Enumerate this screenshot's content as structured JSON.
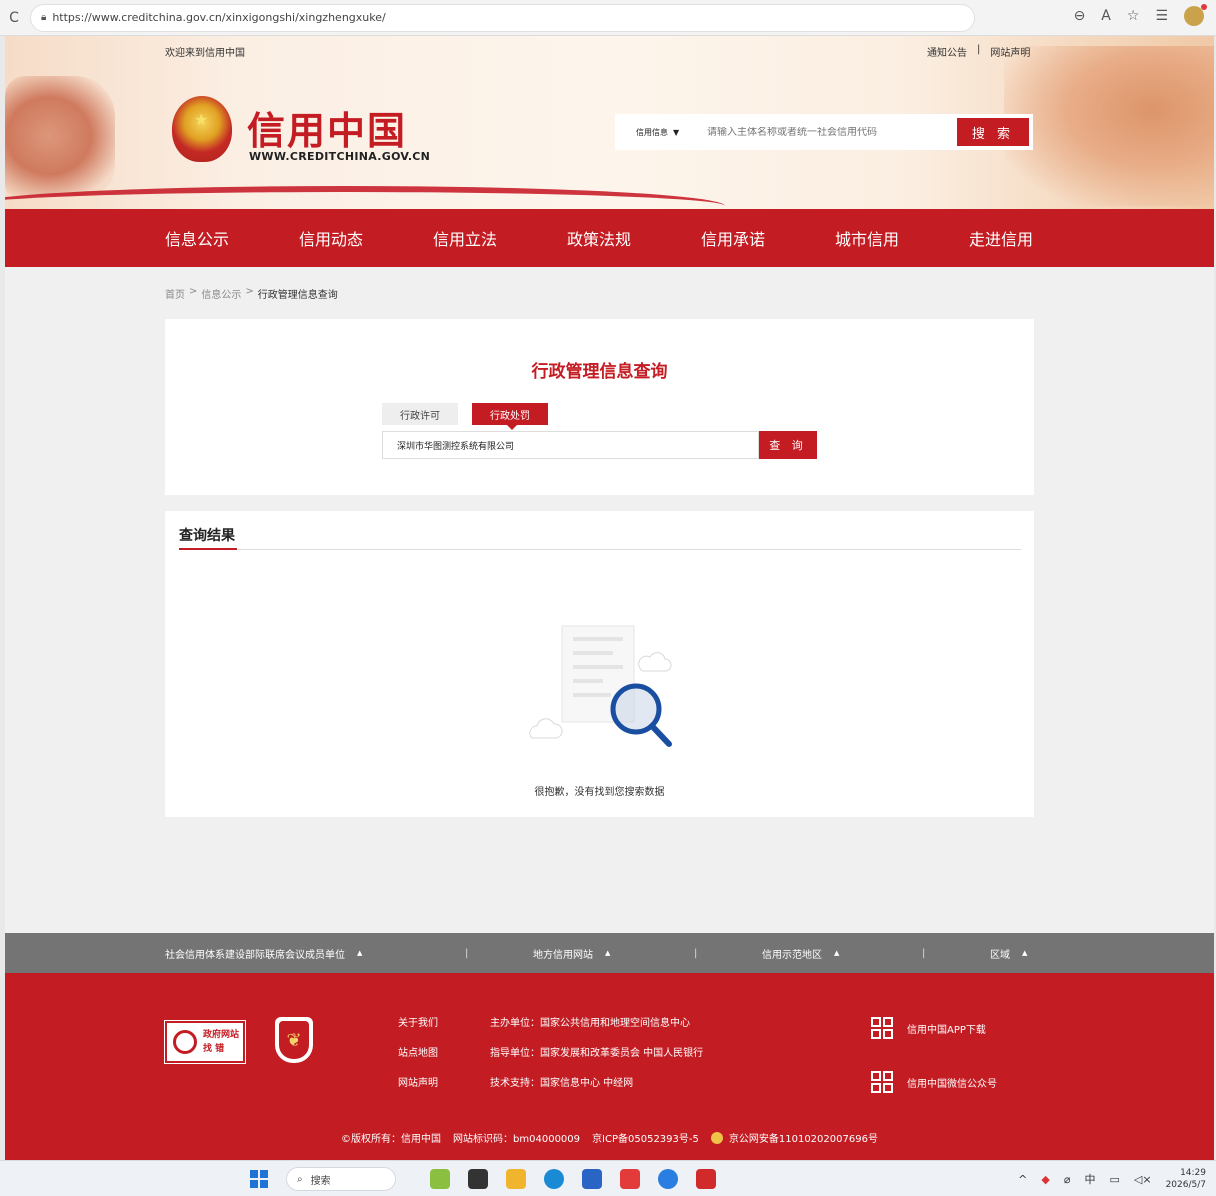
{
  "browser": {
    "url": "https://www.creditchina.gov.cn/xinxigongshi/xingzhengxuke/"
  },
  "header": {
    "welcome": "欢迎来到信用中国",
    "links": [
      "通知公告",
      "|",
      "网站声明"
    ],
    "logo_cn": "信用中国",
    "logo_en": "WWW.CREDITCHINA.GOV.CN",
    "search": {
      "category": "信用信息",
      "placeholder": "请输入主体名称或者统一社会信用代码",
      "button": "搜 索"
    }
  },
  "nav": {
    "items": [
      "信息公示",
      "信用动态",
      "信用立法",
      "政策法规",
      "信用承诺",
      "城市信用",
      "走进信用"
    ]
  },
  "breadcrumb": {
    "items": [
      "首页",
      ">",
      "信息公示",
      ">",
      "行政管理信息查询"
    ]
  },
  "query": {
    "title": "行政管理信息查询",
    "tabs": [
      "行政许可",
      "行政处罚"
    ],
    "active_tab": "行政处罚",
    "input_value": "深圳市华图测控系统有限公司",
    "button": "查 询"
  },
  "result": {
    "heading": "查询结果",
    "empty_message": "很抱歉，没有找到您搜索数据"
  },
  "footer": {
    "groups": [
      "社会信用体系建设部际联席会议成员单位",
      "地方信用网站",
      "信用示范地区",
      "区域"
    ],
    "separator": "|",
    "gov_badge": [
      "政府网站",
      "找 错"
    ],
    "links": [
      "关于我们",
      "站点地图",
      "网站声明"
    ],
    "info": [
      "主办单位：国家公共信用和地理空间信息中心",
      "指导单位：国家发展和改革委员会 中国人民银行",
      "技术支持：国家信息中心 中经网"
    ],
    "app_download": "信用中国APP下载",
    "wechat": "信用中国微信公众号",
    "copyright": "©版权所有：信用中国",
    "site_id": "网站标识码：bm04000009",
    "icp": "京ICP备05052393号-5",
    "police": "京公网安备11010202007696号"
  },
  "taskbar": {
    "search": "搜索",
    "time": "14:29",
    "date": "2026/5/7"
  },
  "colors": {
    "brand_red": "#c41c23",
    "footer_grey": "#747474"
  }
}
